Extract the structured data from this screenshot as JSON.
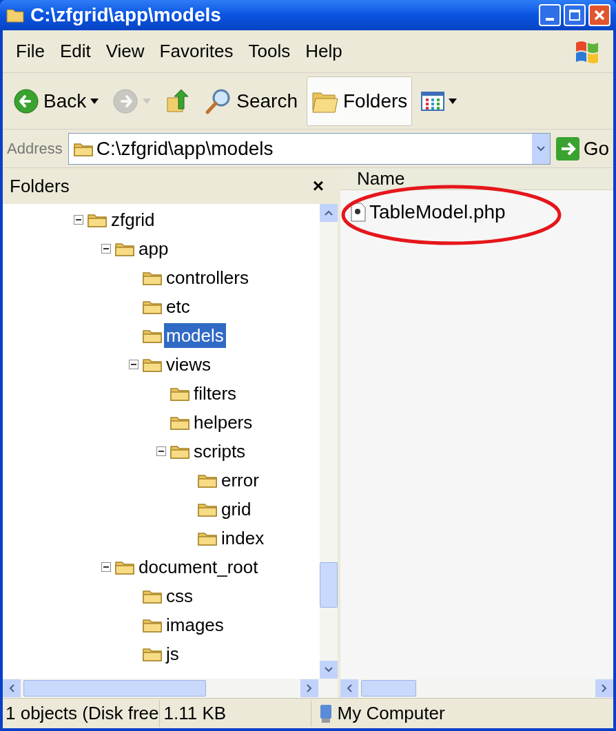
{
  "window": {
    "title": "C:\\zfgrid\\app\\models"
  },
  "menu": [
    "File",
    "Edit",
    "View",
    "Favorites",
    "Tools",
    "Help"
  ],
  "toolbar": [
    {
      "kind": "back",
      "label": "Back",
      "disabled": false,
      "selected": false
    },
    {
      "kind": "forward",
      "disabled": true,
      "selected": false
    },
    {
      "kind": "up",
      "disabled": false,
      "selected": false
    },
    {
      "kind": "search",
      "label": "Search",
      "disabled": false,
      "selected": false
    },
    {
      "kind": "folders",
      "label": "Folders",
      "disabled": false,
      "selected": true
    },
    {
      "kind": "views",
      "disabled": false,
      "selected": false
    }
  ],
  "address": {
    "label": "Address",
    "value": "C:\\zfgrid\\app\\models",
    "go": "Go"
  },
  "folders_pane": {
    "title": "Folders",
    "close": "×",
    "tree": [
      {
        "label": "zfgrid",
        "selected": false,
        "expanded": true,
        "children": [
          {
            "label": "app",
            "selected": false,
            "expanded": true,
            "children": [
              {
                "label": "controllers",
                "selected": false
              },
              {
                "label": "etc",
                "selected": false
              },
              {
                "label": "models",
                "selected": true
              },
              {
                "label": "views",
                "selected": false,
                "expanded": true,
                "children": [
                  {
                    "label": "filters",
                    "selected": false
                  },
                  {
                    "label": "helpers",
                    "selected": false
                  },
                  {
                    "label": "scripts",
                    "selected": false,
                    "expanded": true,
                    "children": [
                      {
                        "label": "error",
                        "selected": false
                      },
                      {
                        "label": "grid",
                        "selected": false
                      },
                      {
                        "label": "index",
                        "selected": false
                      }
                    ]
                  }
                ]
              }
            ]
          },
          {
            "label": "document_root",
            "selected": false,
            "expanded": true,
            "children": [
              {
                "label": "css",
                "selected": false
              },
              {
                "label": "images",
                "selected": false
              },
              {
                "label": "js",
                "selected": false
              }
            ]
          }
        ]
      }
    ]
  },
  "files": {
    "column": "Name",
    "items": [
      {
        "name": "TableModel.php",
        "selected": false
      }
    ]
  },
  "status_bar": {
    "objects": "1 objects (Disk free",
    "size": "1.11 KB",
    "zone": "My Computer"
  }
}
